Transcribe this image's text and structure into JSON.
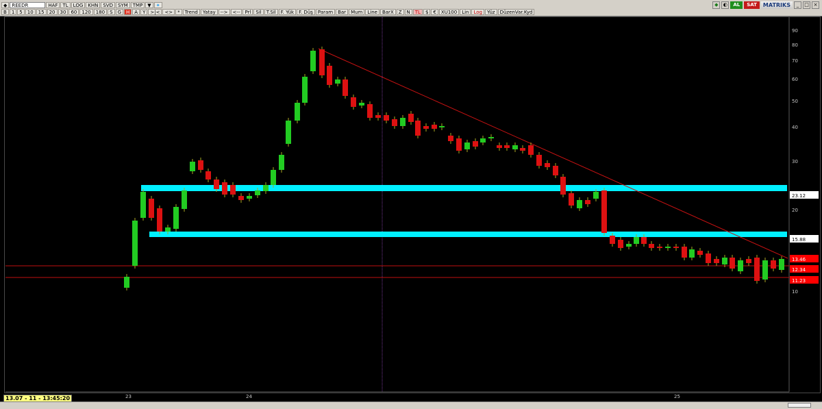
{
  "toolbar": {
    "symbol": "REEDR",
    "row1": [
      "HAF",
      "TL",
      "LOG",
      "KHN",
      "SVD",
      "SYM",
      "TMP"
    ],
    "intervals": [
      "B",
      "1",
      "5",
      "10",
      "15",
      "20",
      "30",
      "60",
      "120",
      "180",
      "S",
      "G",
      "H",
      "A",
      "Y"
    ],
    "nav": [
      ">|<",
      "<>",
      "*"
    ],
    "tools": [
      "Trend",
      "Yatay",
      "-->",
      "<--",
      "Prl",
      "Sil",
      "T.Sil",
      "F. Yük",
      "F. Düş",
      "Param"
    ],
    "types": [
      "Bar",
      "Mum",
      "Line",
      "BarX"
    ],
    "misc": [
      "Z",
      "N",
      "TL",
      "$",
      "€"
    ],
    "index": "XU100",
    "scales": [
      "Lin",
      "Log",
      "Yüz"
    ],
    "edit": "DüzenVar.Kyd",
    "al": "AL",
    "sat": "SAT",
    "brand": "MATRIKS"
  },
  "status": {
    "datetime": "13.07 - 11 - 13:45:20"
  },
  "chart": {
    "y_ticks": [
      "90",
      "80",
      "70",
      "60",
      "50",
      "40",
      "30",
      "20",
      "10"
    ],
    "price_tags": [
      {
        "label": "23.12",
        "color": "#000000"
      },
      {
        "label": "15.88",
        "color": "#000000"
      },
      {
        "label": "13.46",
        "color": "#ff0000"
      },
      {
        "label": "12.34",
        "color": "#ff0000"
      },
      {
        "label": "11.23",
        "color": "#ff0000"
      }
    ],
    "x_ticks": [
      "23",
      "24",
      "25"
    ],
    "colors": {
      "up": "#22cc22",
      "down": "#dd1111",
      "zone": "#00f0ff",
      "line": "#cc1111"
    }
  }
}
